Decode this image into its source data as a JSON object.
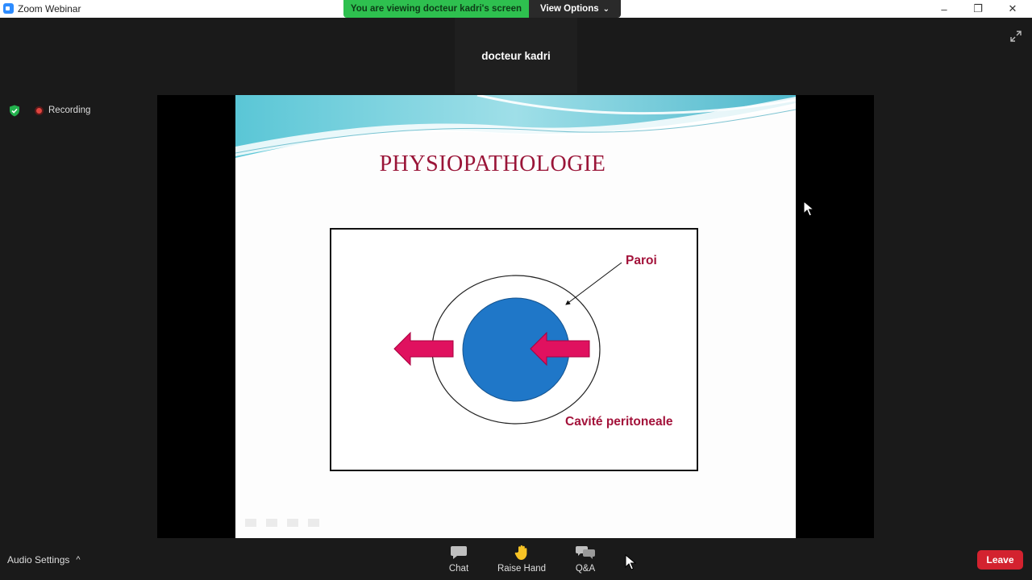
{
  "window": {
    "title": "Zoom Webinar",
    "minimize_glyph": "–",
    "restore_glyph": "❐",
    "close_glyph": "✕"
  },
  "banner": {
    "viewing_text": "You are viewing docteur kadri's screen",
    "view_options_label": "View Options",
    "chevron": "⌄"
  },
  "speaker": {
    "name": "docteur kadri"
  },
  "status": {
    "recording_label": "Recording"
  },
  "slide": {
    "title": "PHYSIOPATHOLOGIE",
    "labels": {
      "paroi": "Paroi",
      "cavite": "Cavité peritoneale"
    },
    "colors": {
      "title": "#9a1538",
      "labels": "#a3123a",
      "arrow": "#e0115f",
      "organ": "#1f77c8"
    }
  },
  "toolbar": {
    "audio_settings_label": "Audio Settings",
    "audio_chevron": "^",
    "chat_label": "Chat",
    "raise_hand_label": "Raise Hand",
    "qa_label": "Q&A",
    "leave_label": "Leave"
  },
  "colors": {
    "accent_green": "#2ec04f",
    "leave_red": "#d3222f",
    "zoom_blue": "#2d8cff"
  }
}
